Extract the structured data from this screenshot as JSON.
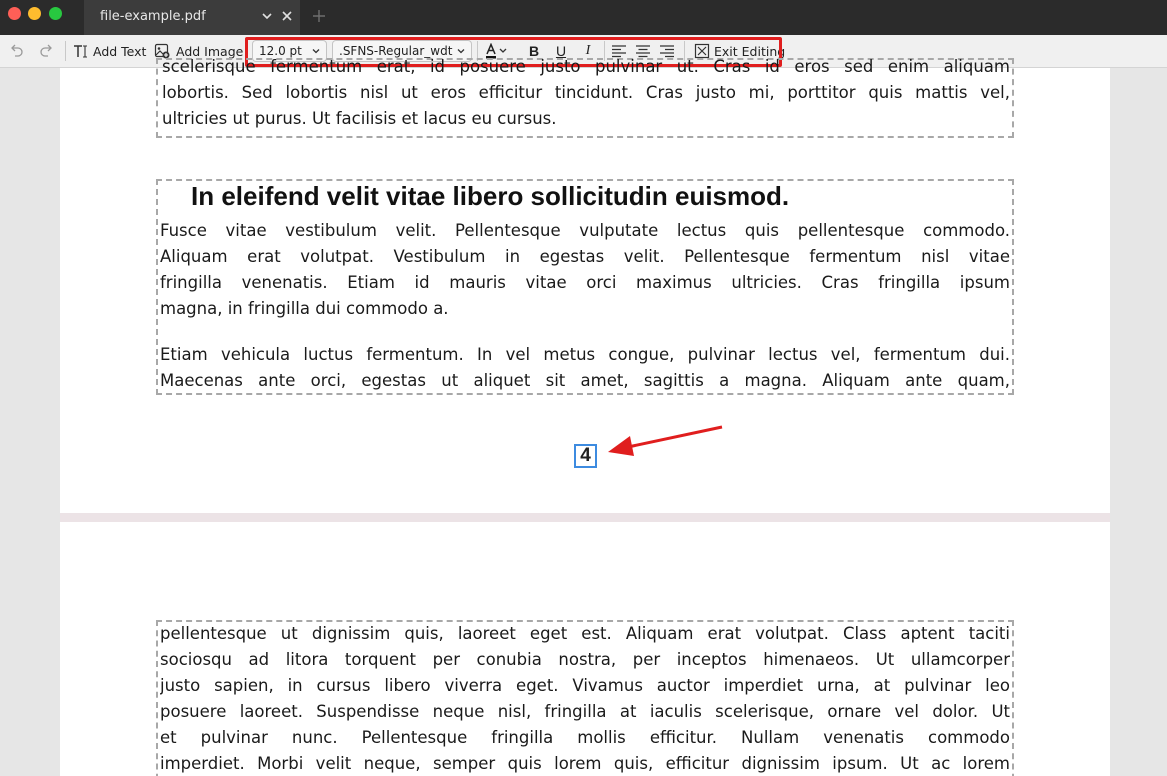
{
  "window": {
    "tab_title": "file-example.pdf"
  },
  "toolbar": {
    "add_text": "Add Text",
    "add_image": "Add Image",
    "font_size": "12.0 pt",
    "font_name": ".SFNS-Regular_wdt",
    "bold": "B",
    "underline": "U",
    "italic": "I",
    "exit_editing": "Exit Editing"
  },
  "colors": {
    "highlight": "#e01e1e",
    "selection": "#3d8be0"
  },
  "page1": {
    "box1_lines": [
      "scelerisque fermentum erat, id posuere justo pulvinar ut. Cras id eros sed enim aliquam",
      "lobortis. Sed lobortis nisl ut eros efficitur tincidunt. Cras justo mi, porttitor quis mattis vel,"
    ],
    "box1_last": "ultricies ut purus. Ut facilisis et lacus eu cursus.",
    "heading": "In eleifend velit vitae libero sollicitudin euismod.",
    "para1_lines": [
      "Fusce vitae vestibulum velit. Pellentesque vulputate lectus quis pellentesque commodo.",
      "Aliquam erat volutpat. Vestibulum in egestas velit. Pellentesque fermentum nisl vitae",
      "fringilla venenatis. Etiam id mauris vitae orci maximus ultricies. Cras fringilla ipsum"
    ],
    "para1_last": "magna, in fringilla dui commodo a.",
    "para2_lines": [
      "Etiam vehicula luctus fermentum. In vel metus congue, pulvinar lectus vel, fermentum dui.",
      "Maecenas ante orci, egestas ut aliquet sit amet, sagittis a magna. Aliquam ante quam,"
    ],
    "page_number": "4"
  },
  "page2": {
    "lines": [
      "pellentesque ut dignissim quis, laoreet eget est. Aliquam erat volutpat. Class aptent taciti",
      "sociosqu ad litora torquent per conubia nostra, per inceptos himenaeos. Ut ullamcorper",
      "justo sapien, in cursus libero viverra eget. Vivamus auctor imperdiet urna, at pulvinar leo",
      "posuere laoreet. Suspendisse neque nisl, fringilla at iaculis scelerisque, ornare vel dolor. Ut",
      "et pulvinar nunc. Pellentesque fringilla mollis efficitur. Nullam venenatis commodo",
      "imperdiet. Morbi velit neque, semper quis lorem quis, efficitur dignissim ipsum. Ut ac lorem"
    ]
  }
}
